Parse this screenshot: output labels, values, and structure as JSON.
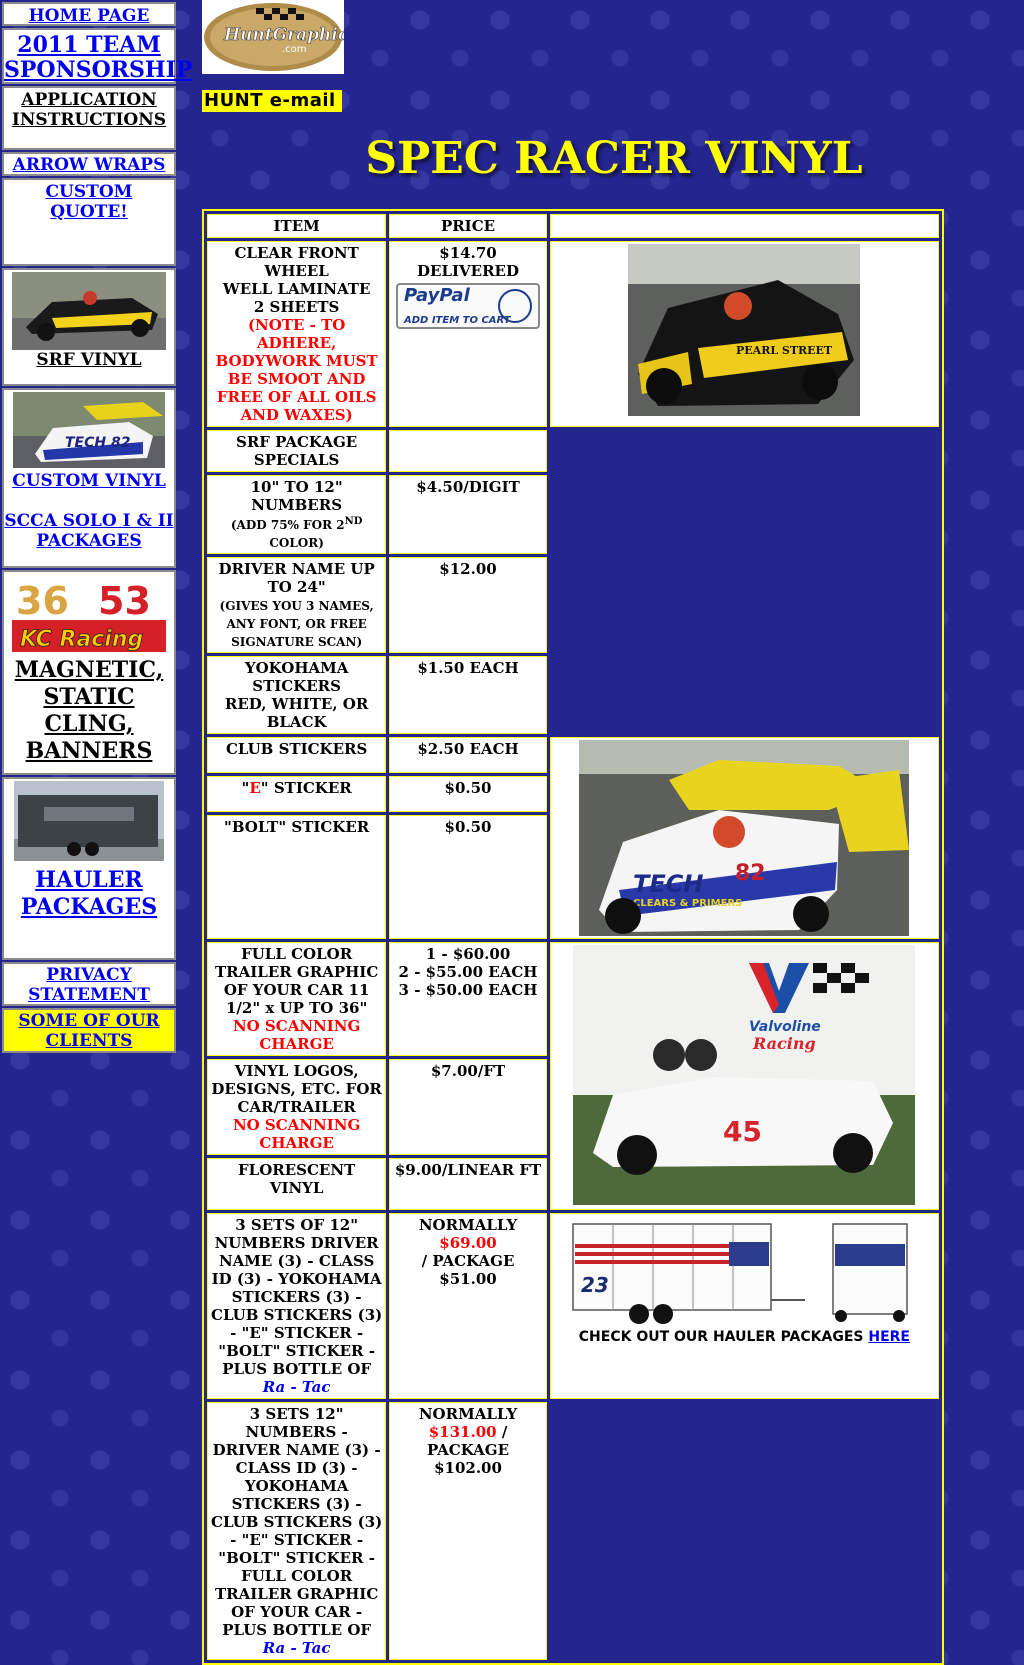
{
  "nav": {
    "home": "HOME PAGE",
    "team_line1": "2011 TEAM",
    "team_line2": "SPONSORSHIP",
    "app_line1": "APPLICATION",
    "app_line2": "INSTRUCTIONS",
    "arrow": "ARROW WRAPS",
    "quote_line1": "CUSTOM",
    "quote_line2": "QUOTE!",
    "srf": "SRF VINYL",
    "custom_vinyl": "CUSTOM VINYL",
    "scca_line1": "SCCA SOLO I & II",
    "scca_line2": "PACKAGES",
    "mag_line1": "MAGNETIC,",
    "mag_line2": "STATIC",
    "mag_line3": "CLING,",
    "mag_line4": "BANNERS",
    "hauler_line1": "HAULER",
    "hauler_line2": "PACKAGES",
    "privacy_line1": "PRIVACY",
    "privacy_line2": "STATEMENT",
    "clients_line1": "SOME OF OUR",
    "clients_line2": "CLIENTS"
  },
  "thumbs": {
    "kc_num1": "36",
    "kc_num2": "53",
    "kc_brand": "KC Racing"
  },
  "header": {
    "logo_text": "HuntGraphic",
    "logo_sub": ".com",
    "email": "HUNT e-mail",
    "title": "SPEC RACER VINYL"
  },
  "table": {
    "col_item": "ITEM",
    "col_price": "PRICE",
    "rows": {
      "wheel": {
        "item_a": "CLEAR FRONT",
        "item_b": "WHEEL",
        "item_c": "WELL LAMINATE",
        "item_d": "2 SHEETS",
        "note": "(NOTE - TO ADHERE, BODYWORK MUST BE SMOOT AND FREE OF ALL OILS AND WAXES)",
        "price": "$14.70 DELIVERED",
        "paypal": "PayPal",
        "paypal_add": "ADD ITEM TO CART"
      },
      "srf_pkg": {
        "item": "SRF PACKAGE SPECIALS"
      },
      "numbers": {
        "item": "10\" TO 12\" NUMBERS",
        "note_a": "(ADD 75% FOR 2",
        "note_sup": "ND",
        "note_b": " COLOR)",
        "price": "$4.50/DIGIT"
      },
      "driver": {
        "item": "DRIVER NAME UP TO 24\"",
        "note": "(GIVES YOU 3 NAMES, ANY FONT, OR FREE SIGNATURE SCAN)",
        "price": "$12.00"
      },
      "yokohama": {
        "item_a": "YOKOHAMA STICKERS",
        "item_b": "RED, WHITE, OR BLACK",
        "price": "$1.50 EACH"
      },
      "club": {
        "item": "CLUB STICKERS",
        "price": "$2.50 EACH"
      },
      "e_sticker": {
        "item_a": "\"",
        "item_e": "E",
        "item_b": "\" STICKER",
        "price": "$0.50"
      },
      "bolt": {
        "item": "\"BOLT\" STICKER",
        "price": "$0.50"
      },
      "trailer": {
        "item_a": "FULL COLOR TRAILER GRAPHIC OF YOUR CAR 11 1/2\" x UP TO 36\"",
        "item_red": "NO SCANNING CHARGE",
        "price_a": "1 - $60.00",
        "price_b": "2 - $55.00 EACH",
        "price_c": "3 - $50.00 EACH"
      },
      "logos": {
        "item_a": "VINYL LOGOS, DESIGNS, ETC. FOR CAR/TRAILER",
        "item_red": "NO SCANNING CHARGE",
        "price": "$7.00/FT"
      },
      "florescent": {
        "item": "FLORESCENT VINYL",
        "price": "$9.00/LINEAR FT"
      },
      "pkg1": {
        "item_a": "3 SETS OF 12\" NUMBERS DRIVER NAME (3) - CLASS ID (3) - YOKOHAMA STICKERS  (3) - CLUB STICKERS (3) - \"E\" STICKER - \"BOLT\" STICKER - PLUS BOTTLE OF ",
        "item_ital": "Ra - Tac",
        "price_a": "NORMALLY ",
        "price_red": "$69.00",
        "price_b": "/ PACKAGE $51.00",
        "caption": "CHECK OUT OUR HAULER PACKAGES ",
        "caption_link": "HERE",
        "trailer_number": "23"
      },
      "pkg2": {
        "item_a": "3 SETS 12\" NUMBERS - DRIVER NAME (3) - CLASS ID (3) - YOKOHAMA STICKERS  (3) - CLUB STICKERS (3) - \"E\" STICKER - \"BOLT\" STICKER - FULL COLOR TRAILER GRAPHIC OF YOUR CAR -  PLUS BOTTLE OF ",
        "item_ital": "Ra - Tac",
        "price_a": "NORMALLY",
        "price_red": "$131.00",
        "price_b": " / PACKAGE $102.00"
      }
    }
  },
  "photos": {
    "photo1_sponsor": "PEARL STREET",
    "photo2_sponsor": "TECH",
    "photo2_number": "82",
    "photo2_sub": "CLEARS & PRIMERS",
    "photo3_brand": "Valvoline",
    "photo3_sub": "Racing",
    "photo3_number": "45"
  },
  "colors": {
    "background": "#24258f",
    "title": "#ffff00",
    "link": "#0000ee",
    "accent_red": "#ff0000"
  }
}
